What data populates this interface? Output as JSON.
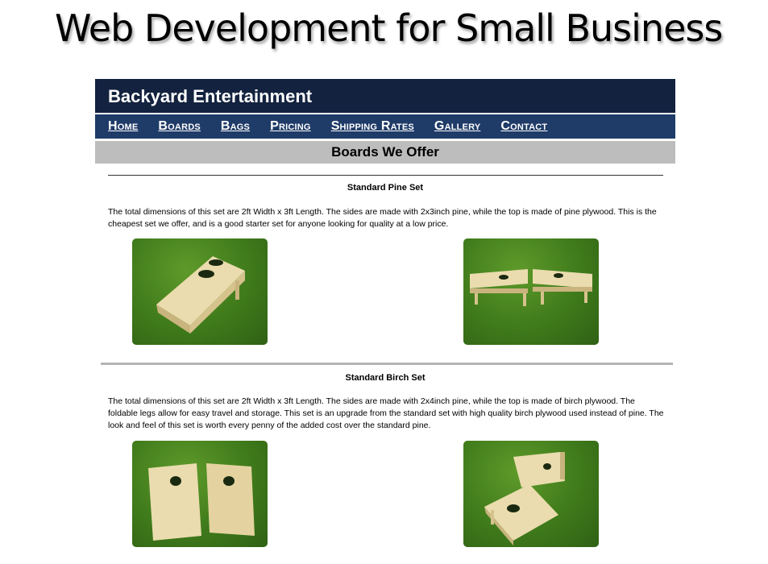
{
  "banner": {
    "title": "Web Development for Small Business"
  },
  "site": {
    "name": "Backyard Entertainment",
    "nav": [
      {
        "label": "Home"
      },
      {
        "label": "Boards"
      },
      {
        "label": "Bags"
      },
      {
        "label": "Pricing"
      },
      {
        "label": "Shipping Rates"
      },
      {
        "label": "Gallery"
      },
      {
        "label": "Contact"
      }
    ],
    "section_title": "Boards We Offer"
  },
  "sets": [
    {
      "title": "Standard Pine Set",
      "description": "The total dimensions of this set are 2ft Width x 3ft Length. The sides are made with 2x3inch pine, while the top is made of pine plywood. This is the cheapest set we offer, and is a good starter set for anyone looking for quality at a low price."
    },
    {
      "title": "Standard Birch Set",
      "description": "The total dimensions of this set are 2ft Width x 3ft Length. The sides are made with 2x4inch pine, while the top is made of birch plywood. The foldable legs allow for easy travel and storage. This set is an upgrade from the standard set with high quality birch plywood used instead of pine. The look and feel of this set is worth every penny of the added cost over the standard pine."
    }
  ],
  "colors": {
    "header_bg": "#13223f",
    "nav_bg": "#1f3b68",
    "section_bg": "#bdbdbd",
    "grass": "#3f7a1b",
    "wood": "#e8d9a8"
  }
}
